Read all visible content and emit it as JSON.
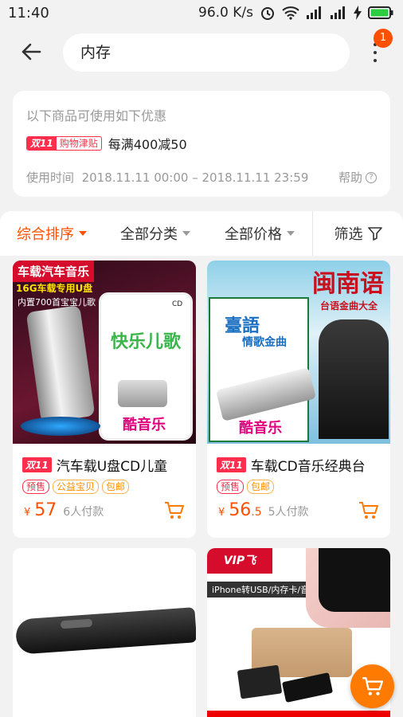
{
  "status": {
    "time": "11:40",
    "speed": "96.0 K/s"
  },
  "search": {
    "query": "内存",
    "badge": "1"
  },
  "promo": {
    "title": "以下商品可使用如下优惠",
    "tag_a": "双11",
    "tag_b": "购物津贴",
    "text": "每满400减50",
    "time_label": "使用时间",
    "time_range": "2018.11.11 00:00 – 2018.11.11 23:59",
    "help": "帮助",
    "help_icon": "?"
  },
  "sort": {
    "items": [
      "综合排序",
      "全部分类",
      "全部价格"
    ],
    "filter": "筛选"
  },
  "products": [
    {
      "title": "汽车载U盘CD儿童",
      "tag": "双11",
      "chips": [
        "预售",
        "公益宝贝",
        "包邮"
      ],
      "currency": "¥",
      "price": "57",
      "decimal": "",
      "paid": "6人付款",
      "img_lines": [
        "车载汽车音乐",
        "16G车载专用U盘",
        "内置700首宝宝儿歌",
        "快乐儿歌",
        "CD",
        "酷",
        "音乐"
      ]
    },
    {
      "title": "车载CD音乐经典台",
      "tag": "双11",
      "chips": [
        "预售",
        "包邮"
      ],
      "currency": "¥",
      "price": "56",
      "decimal": ".5",
      "paid": "5人付款",
      "img_lines": [
        "闽南语",
        "台语金曲大全",
        "臺語",
        "情歌金曲",
        "酷",
        "音乐"
      ]
    },
    {
      "title": "",
      "img_lines": []
    },
    {
      "title": "",
      "img_lines": [
        "VIP飞",
        "iPhone转USB/内存卡/音频"
      ]
    }
  ]
}
